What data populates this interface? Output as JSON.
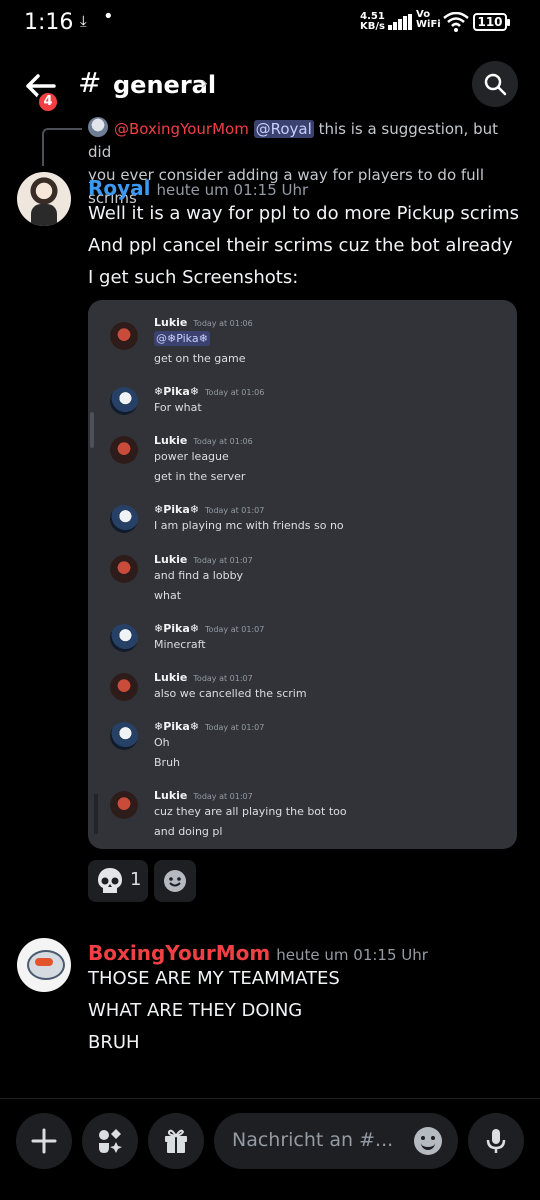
{
  "status_bar": {
    "time": "1:16",
    "download_icon": "download-icon",
    "dot": "•",
    "net_speed_value": "4.51",
    "net_speed_unit": "KB/s",
    "vo": "Vo",
    "wifi_label": "WiFi",
    "battery": "110"
  },
  "header": {
    "back_badge": "4",
    "hash": "#",
    "channel_name": "general",
    "chevron": "›"
  },
  "reply_preview": {
    "author": "@BoxingYourMom",
    "mention": "@Royal",
    "text_line1": " this is a suggestion, but did",
    "text_line2": "you ever consider adding a way for players to do full scrims"
  },
  "messages": [
    {
      "author": "Royal",
      "author_color": "#3b9bf3",
      "timestamp": "heute um 01:15 Uhr",
      "lines": [
        "Well it is a way for ppl to do more Pickup scrims",
        "And ppl cancel their scrims cuz the bot already",
        "I get such Screenshots:"
      ]
    },
    {
      "author": "BoxingYourMom",
      "author_color": "#f23f43",
      "timestamp": "heute um 01:15 Uhr",
      "lines": [
        "THOSE ARE MY TEAMMATES",
        "WHAT ARE THEY DOING",
        "BRUH"
      ]
    }
  ],
  "screenshot": {
    "messages": [
      {
        "author": "Lukie",
        "time": "Today at 01:06",
        "mention": "@❄Pika❄",
        "lines": [
          "get on the game"
        ]
      },
      {
        "author": "❄Pika❄",
        "time": "Today at 01:06",
        "lines": [
          "For what"
        ]
      },
      {
        "author": "Lukie",
        "time": "Today at 01:06",
        "lines": [
          "power league",
          "get in the server"
        ]
      },
      {
        "author": "❄Pika❄",
        "time": "Today at 01:07",
        "lines": [
          "I am playing mc with friends so no"
        ]
      },
      {
        "author": "Lukie",
        "time": "Today at 01:07",
        "lines": [
          "and find a lobby",
          "what"
        ]
      },
      {
        "author": "❄Pika❄",
        "time": "Today at 01:07",
        "lines": [
          "Minecraft"
        ]
      },
      {
        "author": "Lukie",
        "time": "Today at 01:07",
        "lines": [
          "also we cancelled the scrim"
        ]
      },
      {
        "author": "❄Pika❄",
        "time": "Today at 01:07",
        "lines": [
          "Oh",
          "Bruh"
        ]
      },
      {
        "author": "Lukie",
        "time": "Today at 01:07",
        "lines": [
          "cuz they are all playing the bot too",
          "and doing pl"
        ]
      }
    ]
  },
  "reactions": {
    "skull_count": "1",
    "skull_icon": "skull-icon",
    "add_icon": "add-reaction-icon"
  },
  "composer": {
    "placeholder": "Nachricht an #...",
    "plus_icon": "plus-icon",
    "apps_icon": "apps-icon",
    "gift_icon": "gift-icon",
    "emoji_icon": "emoji-icon",
    "mic_icon": "microphone-icon"
  }
}
